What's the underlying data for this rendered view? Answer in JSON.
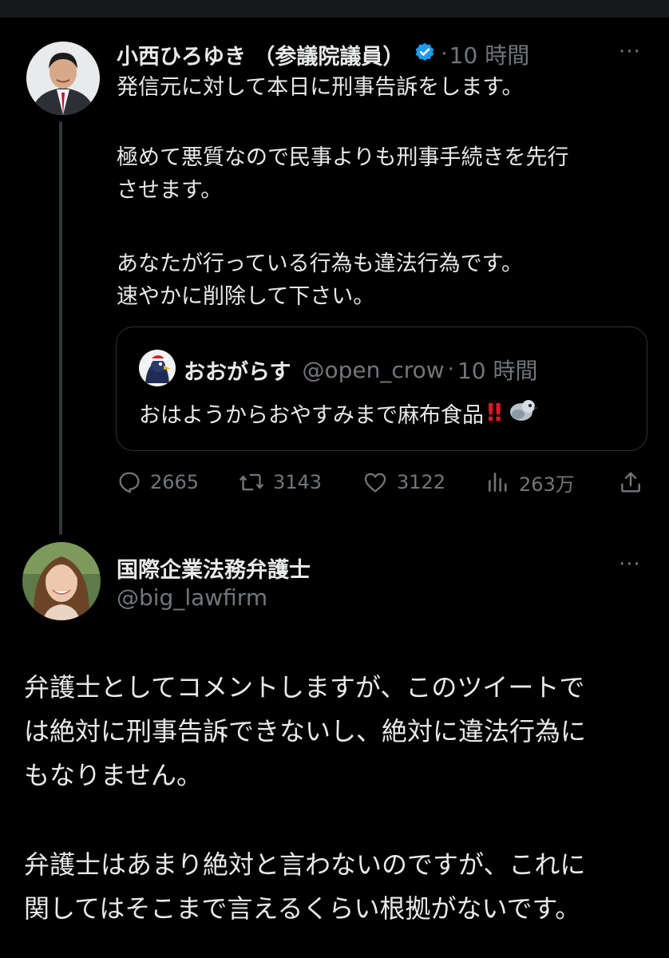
{
  "tweet1": {
    "author_name": "小西ひろゆき （参議院議員）",
    "time": "10 時間",
    "dot": "·",
    "more": "···",
    "lines": [
      "発信元に対して本日に刑事告訴をします。",
      "極めて悪質なので民事よりも刑事手続きを先行",
      "させます。",
      "あなたが行っている行為も違法行為です。",
      "速やかに削除して下さい。"
    ],
    "quote": {
      "author_name": "おおがらす",
      "handle": "@open_crow",
      "dot": "·",
      "time": "10 時間",
      "text": "おはようからおやすみまで麻布食品",
      "emoji_text": "‼"
    },
    "actions": {
      "replies": "2665",
      "retweets": "3143",
      "likes": "3122",
      "views": "263万"
    }
  },
  "tweet2": {
    "author_name": "国際企業法務弁護士",
    "handle": "@big_lawfirm",
    "more": "···",
    "lines": [
      "弁護士としてコメントしますが、このツイートで",
      "は絶対に刑事告訴できないし、絶対に違法行為に",
      "もなりません。",
      "弁護士はあまり絶対と言わないのですが、これに",
      "関してはそこまで言えるくらい根拠がないです。"
    ]
  },
  "colors": {
    "background": "#000000",
    "text": "#e7e9ea",
    "muted": "#71767b",
    "verified": "#1d9bf0",
    "border": "#2f3336",
    "emoji_red": "#e0162b"
  },
  "icons": [
    "verified-badge-icon",
    "reply-icon",
    "retweet-icon",
    "like-icon",
    "views-icon",
    "share-icon",
    "more-icon"
  ]
}
